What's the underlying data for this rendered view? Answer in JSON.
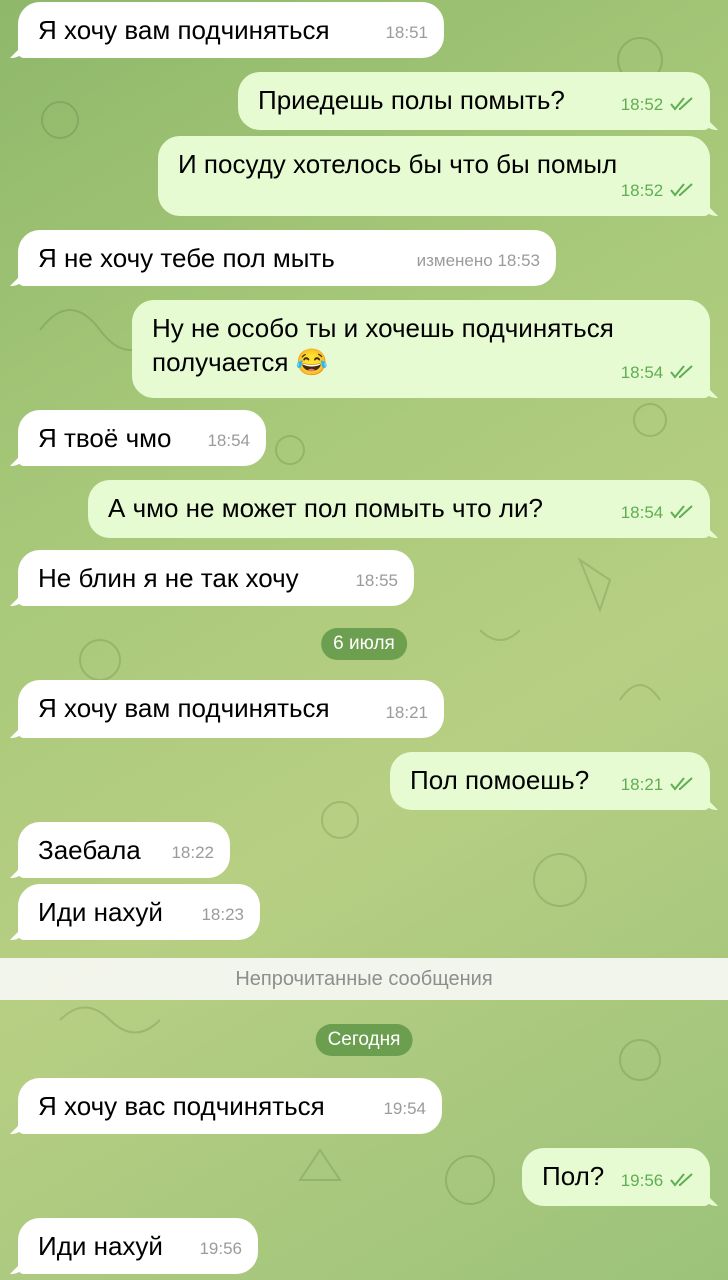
{
  "messages": [
    {
      "text": "Я хочу вам подчиняться",
      "time": "18:51"
    },
    {
      "text": "Приедешь полы помыть?",
      "time": "18:52"
    },
    {
      "text": "И посуду хотелось бы что бы  помыл",
      "time": "18:52"
    },
    {
      "text": "Я не хочу тебе пол мыть",
      "time": "изменено 18:53"
    },
    {
      "line1": "Ну не особо ты и хочешь подчиняться",
      "line2": "получается 😂",
      "time": "18:54"
    },
    {
      "text": "Я твоё чмо",
      "time": "18:54"
    },
    {
      "text": "А чмо не может пол помыть что ли?",
      "time": "18:54"
    },
    {
      "text": "Не блин я не так хочу",
      "time": "18:55"
    },
    {
      "text": "Я хочу вам подчиняться",
      "time": "18:21"
    },
    {
      "text": "Пол помоешь?",
      "time": "18:21"
    },
    {
      "text": "Заебала",
      "time": "18:22"
    },
    {
      "text": "Иди нахуй",
      "time": "18:23"
    },
    {
      "text": "Я хочу вас подчиняться",
      "time": "19:54"
    },
    {
      "text": "Пол?",
      "time": "19:56"
    },
    {
      "text": "Иди нахуй",
      "time": "19:56"
    }
  ],
  "dates": {
    "july6": "6 июля",
    "today": "Сегодня"
  },
  "unread_label": "Непрочитанные сообщения",
  "colors": {
    "incoming": "#ffffff",
    "outgoing": "#e7fbd3",
    "check": "#5fae52",
    "date_pill": "#6a9a4a"
  }
}
